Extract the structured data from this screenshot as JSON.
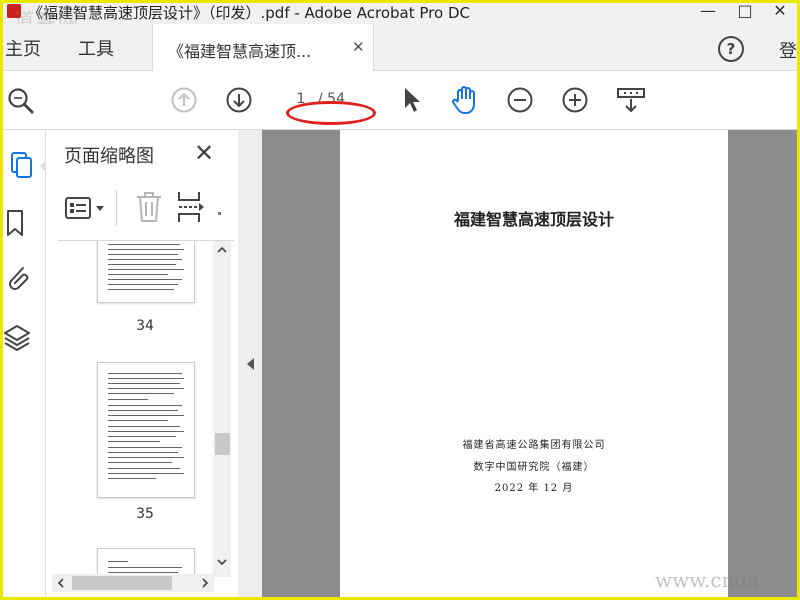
{
  "window": {
    "title": "《福建智慧高速顶层设计》（印发）.pdf - Adobe Acrobat Pro DC",
    "watermark": "道客网",
    "controls": [
      "—",
      "□",
      "✕"
    ]
  },
  "menu": {
    "home": "主页",
    "tools": "工具",
    "signin": "登"
  },
  "tab": {
    "label": "《福建智慧高速顶...",
    "close": "✕"
  },
  "toolbar": {
    "page_current": "1",
    "page_total": "/ 54",
    "help": "?"
  },
  "panel": {
    "title": "页面缩略图",
    "close": "✕"
  },
  "thumbnails": [
    {
      "page": "34"
    },
    {
      "page": "35"
    }
  ],
  "document": {
    "title": "福建智慧高速顶层设计",
    "org1": "福建省高速公路集团有限公司",
    "org2": "数字中国研究院（福建）",
    "date": "2022 年 12 月"
  },
  "site_watermark": "www.cnda",
  "colors": {
    "accent_blue": "#1473e6",
    "highlight_red": "#e0201b",
    "frame_yellow": "#e8e800"
  }
}
